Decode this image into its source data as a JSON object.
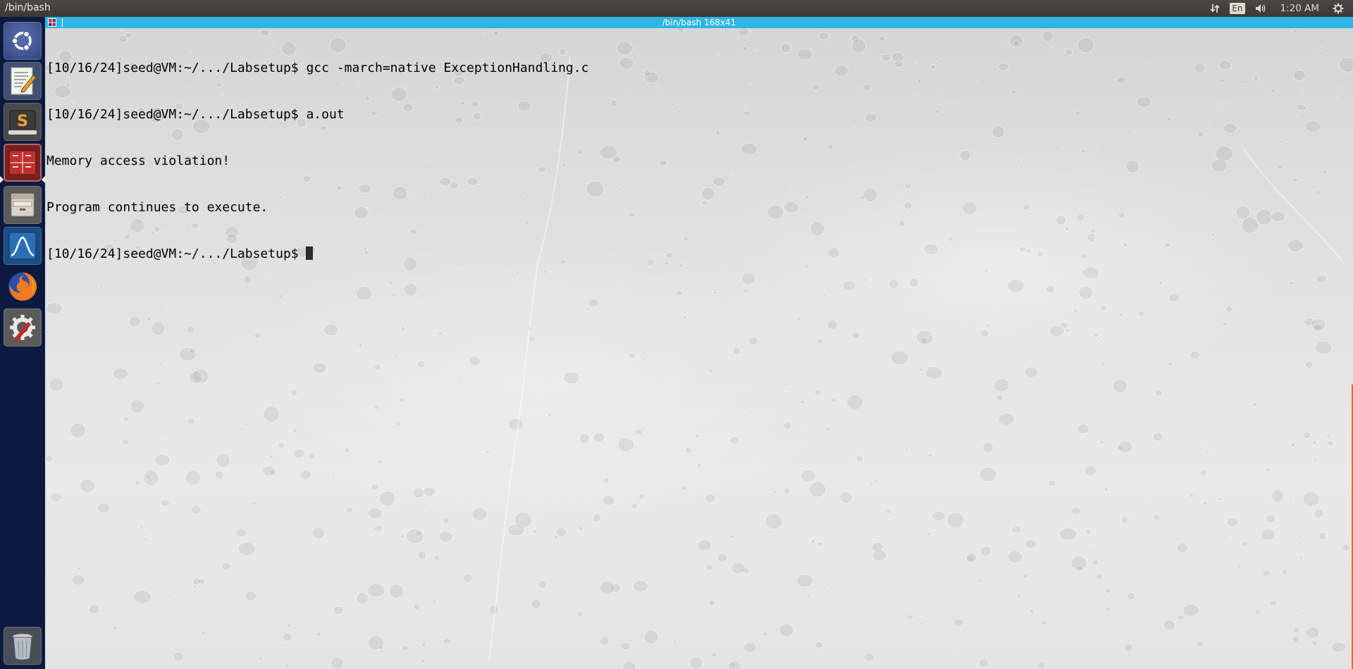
{
  "panel": {
    "title": "/bin/bash",
    "language": "En",
    "clock": "1:20 AM",
    "icons": [
      "network-icon",
      "keyboard-language-icon",
      "volume-icon",
      "settings-gear-icon"
    ]
  },
  "launcher": {
    "items": [
      {
        "name": "ubuntu-dash-icon"
      },
      {
        "name": "text-editor-icon"
      },
      {
        "name": "sublime-text-icon"
      },
      {
        "name": "terminal-icon"
      },
      {
        "name": "file-manager-icon"
      },
      {
        "name": "wireshark-icon"
      },
      {
        "name": "firefox-icon"
      },
      {
        "name": "system-settings-icon"
      },
      {
        "name": "trash-icon"
      }
    ]
  },
  "terminal": {
    "title": "/bin/bash 168x41",
    "lines": [
      "[10/16/24]seed@VM:~/.../Labsetup$ gcc -march=native ExceptionHandling.c",
      "[10/16/24]seed@VM:~/.../Labsetup$ a.out",
      "Memory access violation!",
      "Program continues to execute.",
      "[10/16/24]seed@VM:~/.../Labsetup$ "
    ]
  },
  "colors": {
    "panel_bg": "#3c3b37",
    "launcher_bg": "#0d1a3f",
    "terminal_titlebar": "#2eb5e5",
    "terminal_text": "#000000"
  }
}
